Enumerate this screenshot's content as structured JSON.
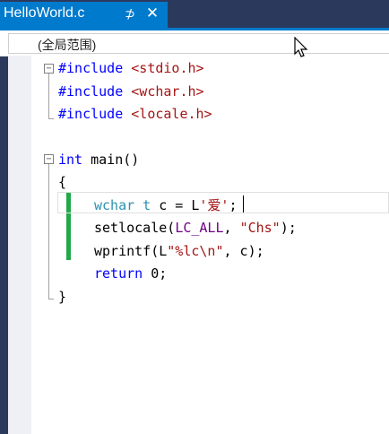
{
  "tab": {
    "title": "HelloWorld.c",
    "pin_glyph": "⊅",
    "close_glyph": "✕"
  },
  "navbar": {
    "scope": "(全局范围)"
  },
  "code": {
    "l1_kw": "#include",
    "l1_inc": "<stdio.h>",
    "l2_kw": "#include",
    "l2_inc": "<wchar.h>",
    "l3_kw": "#include",
    "l3_inc": "<locale.h>",
    "l5_kw": "int",
    "l5_rest": "main()",
    "l6": "{",
    "l7_typ": "wchar_t",
    "l7_mid": "c = L",
    "l7_str": "'爱'",
    "l7_end": ";",
    "l8_a": "setlocale(",
    "l8_mac": "LC_ALL",
    "l8_b": ", ",
    "l8_str": "\"Chs\"",
    "l8_c": ");",
    "l9_a": "wprintf(L",
    "l9_str": "\"%lc\\n\"",
    "l9_b": ", c);",
    "l10_kw": "return",
    "l10_rest": "0;",
    "l11": "}"
  },
  "colors": {
    "keyword": "#0000ff",
    "string": "#a31515",
    "macro": "#6f008a",
    "type": "#2b91af",
    "tab_accent": "#007acc",
    "change_bar": "#22a94a"
  }
}
